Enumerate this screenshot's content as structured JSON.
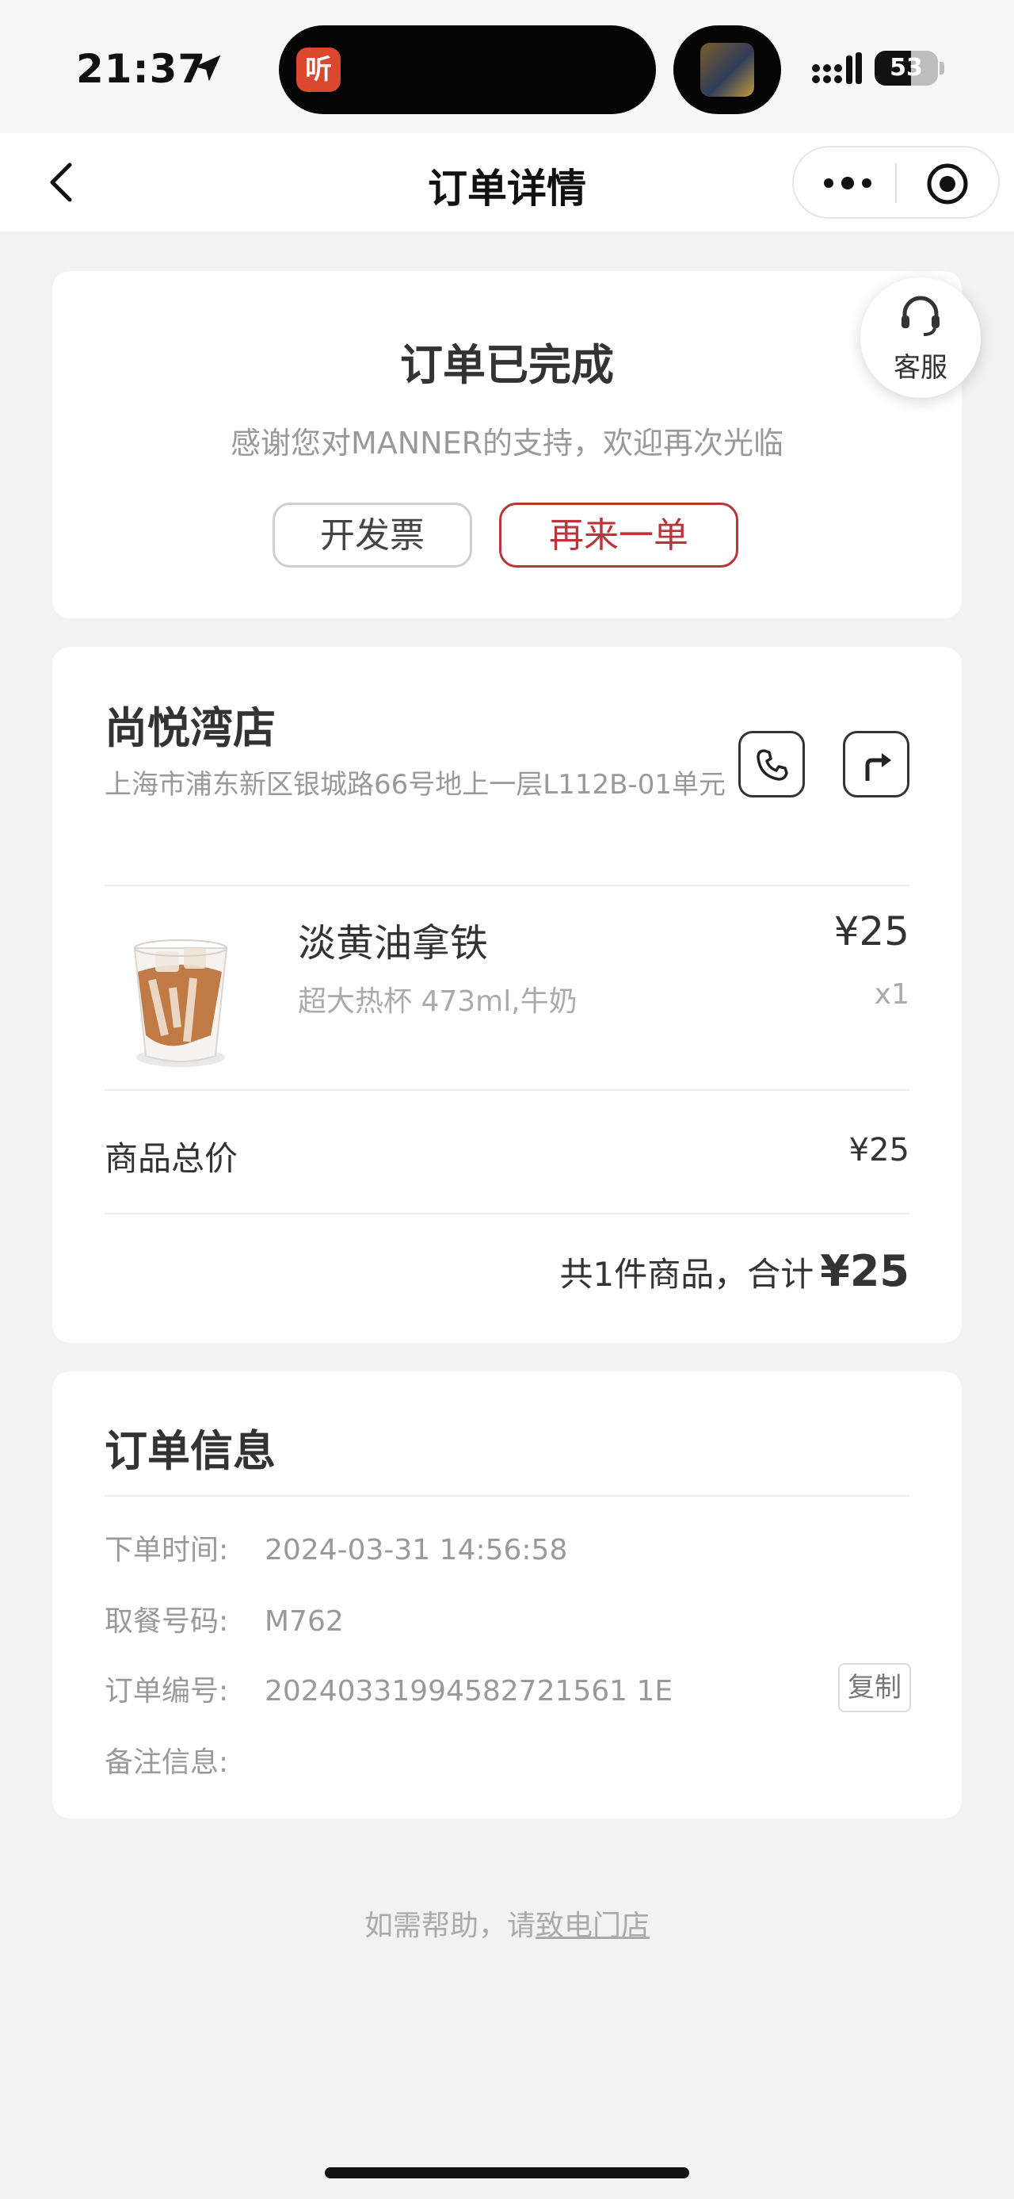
{
  "status_bar": {
    "time": "21:37",
    "app_badge": "听",
    "battery": "53"
  },
  "nav": {
    "title": "订单详情"
  },
  "order_status": {
    "title": "订单已完成",
    "subtitle": "感谢您对MANNER的支持，欢迎再次光临",
    "invoice_button": "开发票",
    "reorder_button": "再来一单",
    "service_label": "客服"
  },
  "store": {
    "name": "尚悦湾店",
    "address": "上海市浦东新区银城路66号地上一层L112B-01单元"
  },
  "product": {
    "name": "淡黄油拿铁",
    "spec": "超大热杯 473ml,牛奶",
    "price": "¥25",
    "quantity": "x1"
  },
  "summary": {
    "subtotal_label": "商品总价",
    "subtotal_value": "¥25",
    "total_prefix": "共1件商品，合计",
    "total_amount": "¥25"
  },
  "order_info": {
    "title": "订单信息",
    "rows": [
      {
        "label": "下单时间:",
        "value": "2024-03-31 14:56:58"
      },
      {
        "label": "取餐号码:",
        "value": "M762"
      },
      {
        "label": "订单编号:",
        "value": "20240331994582721561 1E"
      },
      {
        "label": "备注信息:",
        "value": ""
      }
    ],
    "copy_button": "复制"
  },
  "help": {
    "prefix": "如需帮助，请",
    "link": "致电门店"
  }
}
